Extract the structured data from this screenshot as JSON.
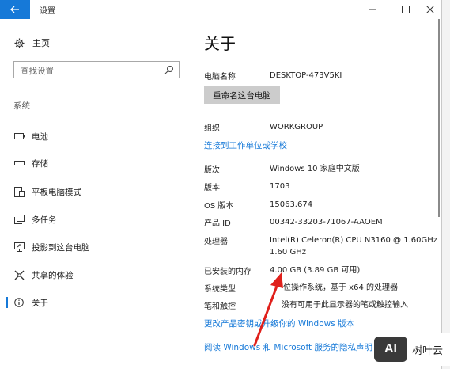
{
  "window": {
    "title": "设置"
  },
  "sidebar": {
    "home_label": "主页",
    "search_placeholder": "查找设置",
    "section_label": "系统",
    "items": [
      {
        "label": "电池",
        "icon": "battery-icon"
      },
      {
        "label": "存储",
        "icon": "storage-icon"
      },
      {
        "label": "平板电脑模式",
        "icon": "tablet-mode-icon"
      },
      {
        "label": "多任务",
        "icon": "multitasking-icon"
      },
      {
        "label": "投影到这台电脑",
        "icon": "projecting-icon"
      },
      {
        "label": "共享的体验",
        "icon": "shared-experiences-icon"
      },
      {
        "label": "关于",
        "icon": "info-icon",
        "active": true
      }
    ]
  },
  "content": {
    "title": "关于",
    "pc_name_key": "电脑名称",
    "pc_name_value": "DESKTOP-473V5KI",
    "rename_button": "重命名这台电脑",
    "org_key": "组织",
    "org_value": "WORKGROUP",
    "connect_link": "连接到工作单位或学校",
    "specs": [
      {
        "k": "版次",
        "v": "Windows 10 家庭中文版"
      },
      {
        "k": "版本",
        "v": "1703"
      },
      {
        "k": "OS 版本",
        "v": "15063.674"
      },
      {
        "k": "产品 ID",
        "v": "00342-33203-71067-AAOEM"
      },
      {
        "k": "处理器",
        "v": "Intel(R) Celeron(R) CPU  N3160  @ 1.60GHz 1.60 GHz"
      },
      {
        "k": "已安装的内存",
        "v": "4.00 GB (3.89 GB 可用)"
      },
      {
        "k": "系统类型",
        "v": "位操作系统，基于 x64 的处理器"
      },
      {
        "k": "笔和触控",
        "v": "没有可用于此显示器的笔或触控输入"
      }
    ],
    "change_key_link": "更改产品密钥或升级你的 Windows 版本",
    "privacy_link": "阅读 Windows 和 Microsoft 服务的隐私声明"
  },
  "annotation": {
    "arrow_color": "#e0201b"
  },
  "watermark": {
    "logo_text": "AI",
    "brand": "树叶云"
  },
  "colors": {
    "accent": "#1679d8"
  }
}
